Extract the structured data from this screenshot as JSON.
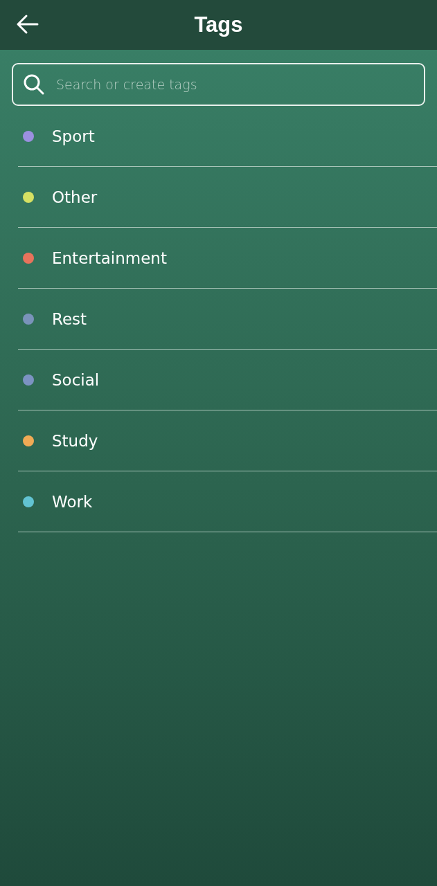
{
  "header": {
    "title": "Tags"
  },
  "search": {
    "placeholder": "Search or create tags"
  },
  "tags": [
    {
      "label": "Sport",
      "color": "#9b90e0"
    },
    {
      "label": "Other",
      "color": "#d6e063"
    },
    {
      "label": "Entertainment",
      "color": "#e8735c"
    },
    {
      "label": "Rest",
      "color": "#7a93ba"
    },
    {
      "label": "Social",
      "color": "#7c93c2"
    },
    {
      "label": "Study",
      "color": "#f0aa55"
    },
    {
      "label": "Work",
      "color": "#62c3d2"
    }
  ]
}
